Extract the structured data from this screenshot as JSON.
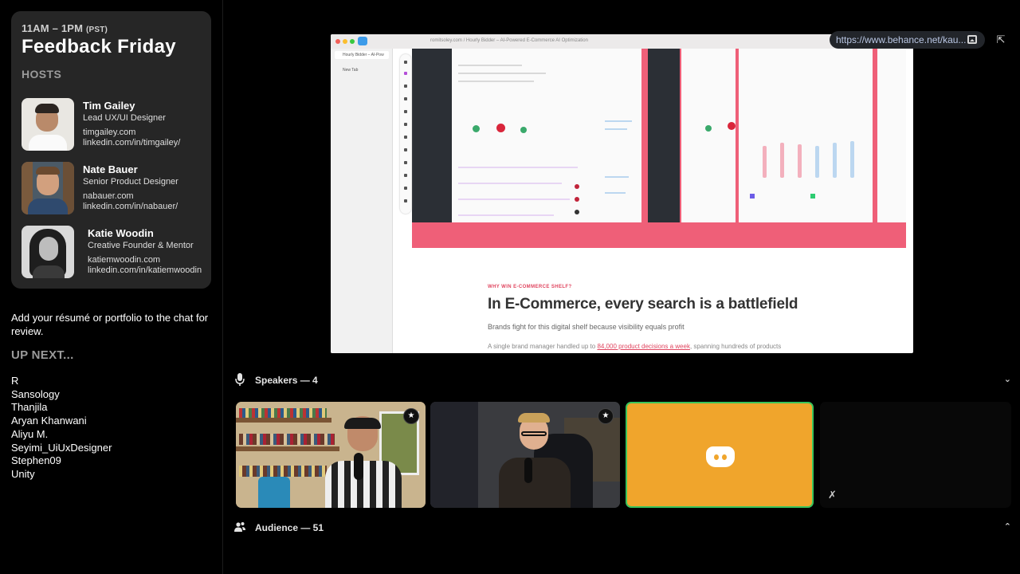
{
  "event": {
    "time": "11AM – 1PM",
    "timezone": "(PST)",
    "title": "Feedback Friday",
    "hosts_label": "HOSTS",
    "hosts": [
      {
        "name": "Tim Gailey",
        "role": "Lead UX/UI Designer",
        "site": "timgailey.com",
        "linkedin": "linkedin.com/in/timgailey/"
      },
      {
        "name": "Nate Bauer",
        "role": "Senior Product Designer",
        "site": "nabauer.com",
        "linkedin": "linkedin.com/in/nabauer/"
      },
      {
        "name": "Katie Woodin",
        "role": "Creative Founder & Mentor",
        "site": "katiemwoodin.com",
        "linkedin": "linkedin.com/in/katiemwoodin"
      }
    ]
  },
  "note": "Add your résumé or portfolio to the chat for review.",
  "up_next": {
    "label": "UP NEXT...",
    "queue": [
      "R",
      "Sansology",
      "Thanjila",
      "Aryan Khanwani",
      "Aliyu M.",
      "Seyimi_UiUxDesigner",
      "Stephen09",
      "Unity"
    ]
  },
  "screen_share": {
    "url": "https://www.behance.net/kau...",
    "browser_tab": "Hourly Bidder – AI-Pow",
    "new_tab": "New Tab",
    "address": "romitsoley.com / Hourly Bidder – AI-Powered E-Commerce AI Optimization",
    "eyebrow": "WHY WIN E-COMMERCE SHELF?",
    "headline": "In E-Commerce, every search is a battlefield",
    "subline": "Brands fight for this digital shelf because visibility equals profit",
    "body_prefix": "A single brand manager handled up to ",
    "body_link": "84,000 product decisions a week",
    "body_suffix": ", spanning hundreds of products"
  },
  "speakers": {
    "label": "Speakers — 4",
    "icon": "microphone-icon",
    "toggle_icon": "chevron-down-icon"
  },
  "audience": {
    "label": "Audience — 51",
    "icon": "people-icon",
    "toggle_icon": "chevron-up-icon"
  },
  "colors": {
    "background": "#000000",
    "card": "#262626",
    "discord_tile": "#f0a52c",
    "speaking_border": "#39c45c",
    "share_accent": "#ef5f78"
  }
}
